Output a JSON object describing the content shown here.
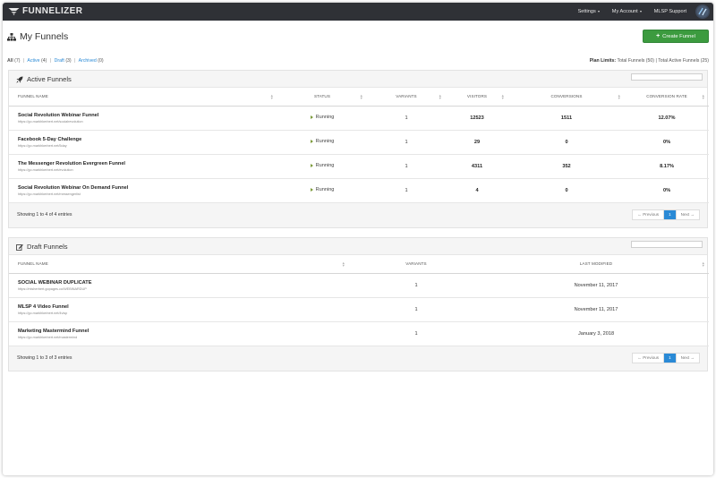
{
  "topbar": {
    "brand": "FUNNELIZER",
    "nav": [
      {
        "label": "Settings",
        "has_caret": true
      },
      {
        "label": "My Account",
        "has_caret": true
      },
      {
        "label": "MLSP Support",
        "has_caret": false
      }
    ]
  },
  "page": {
    "title": "My Funnels",
    "create_button": "Create Funnel",
    "filters": {
      "all": "All",
      "all_count": "(7)",
      "active": "Active",
      "active_count": "(4)",
      "draft": "Draft",
      "draft_count": "(3)",
      "archived": "Archived",
      "archived_count": "(0)"
    },
    "plan": {
      "label": "Plan Limits:",
      "total": "Total Funnels (50)",
      "sep": "|",
      "active": "Total Active Funnels (25)"
    }
  },
  "active_panel": {
    "title": "Active Funnels",
    "columns": [
      "Funnel Name",
      "Status",
      "Variants",
      "Visitors",
      "Conversions",
      "Conversion Rate"
    ],
    "rows": [
      {
        "name": "Social Revolution Webinar Funnel",
        "url": "https://go.markhkerbert.net/socialrevolution",
        "status": "Running",
        "variants": "1",
        "visitors": "12523",
        "conversions": "1511",
        "rate": "12.07%"
      },
      {
        "name": "Facebook 5-Day Challenge",
        "url": "https://go.markhkerbert.net/5day",
        "status": "Running",
        "variants": "1",
        "visitors": "29",
        "conversions": "0",
        "rate": "0%"
      },
      {
        "name": "The Messenger Revolution Evergreen Funnel",
        "url": "https://go.markhkerbert.net/evolution",
        "status": "Running",
        "variants": "1",
        "visitors": "4311",
        "conversions": "352",
        "rate": "8.17%"
      },
      {
        "name": "Social Revolution Webinar On Demand Funnel",
        "url": "https://go.markhkerbert.net/messengerlist",
        "status": "Running",
        "variants": "1",
        "visitors": "4",
        "conversions": "0",
        "rate": "0%"
      }
    ],
    "footer": "Showing 1 to 4 of 4 entries",
    "pager": {
      "prev": "← Previous",
      "current": "1",
      "next": "Next →"
    }
  },
  "draft_panel": {
    "title": "Draft Funnels",
    "columns": [
      "Funnel Name",
      "Variants",
      "Last Modified"
    ],
    "rows": [
      {
        "name": "SOCIAL WEBINAR DUPLICATE",
        "url": "https://mlsherbert.gopages.co/WEBINARDUP",
        "variants": "1",
        "modified": "November 11, 2017"
      },
      {
        "name": "MLSP 4 Video Funnel",
        "url": "https://go.markhkerbert.net/4vlsp",
        "variants": "1",
        "modified": "November 11, 2017"
      },
      {
        "name": "Marketing Mastermind Funnel",
        "url": "https://go.markhkerbert.net/mastermind",
        "variants": "1",
        "modified": "January 3, 2018"
      }
    ],
    "footer": "Showing 1 to 3 of 3 entries",
    "pager": {
      "prev": "← Previous",
      "current": "1",
      "next": "Next →"
    }
  },
  "colors": {
    "topbar": "#2f3136",
    "create_button": "#3c9b3f",
    "link": "#2a8ad6",
    "running": "#7c9a3a"
  },
  "icons": [
    "funnelizer-logo-icon",
    "chevron-down-icon",
    "avatar-icon",
    "sitemap-icon",
    "rocket-icon",
    "edit-icon",
    "play-icon",
    "sort-icon"
  ]
}
